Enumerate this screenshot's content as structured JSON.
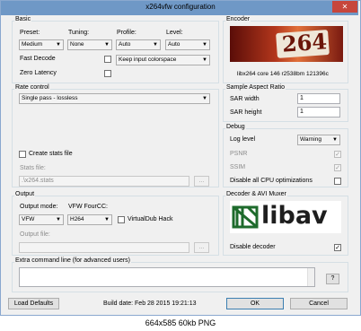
{
  "window": {
    "title": "x264vfw configuration",
    "close_label": "✕"
  },
  "basic": {
    "title": "Basic",
    "preset_label": "Preset:",
    "preset_value": "Medium",
    "tuning_label": "Tuning:",
    "tuning_value": "None",
    "profile_label": "Profile:",
    "profile_value": "Auto",
    "level_label": "Level:",
    "level_value": "Auto",
    "fast_decode_label": "Fast Decode",
    "zero_latency_label": "Zero Latency",
    "colorspace_value": "Keep input colorspace"
  },
  "encoder": {
    "title": "Encoder",
    "logo_text": "264",
    "core_text": "libx264 core 146 r2538bm 121396c"
  },
  "rate_control": {
    "title": "Rate control",
    "mode_value": "Single pass - lossless",
    "create_stats_label": "Create stats file",
    "stats_file_label": "Stats file:",
    "stats_file_value": ".\\x264.stats",
    "browse_label": "..."
  },
  "sar": {
    "title": "Sample Aspect Ratio",
    "width_label": "SAR width",
    "width_value": "1",
    "height_label": "SAR height",
    "height_value": "1"
  },
  "debug": {
    "title": "Debug",
    "log_level_label": "Log level",
    "log_level_value": "Warning",
    "psnr_label": "PSNR",
    "ssim_label": "SSIM",
    "disable_cpu_label": "Disable all CPU optimizations"
  },
  "output": {
    "title": "Output",
    "mode_label": "Output mode:",
    "mode_value": "VFW",
    "fourcc_label": "VFW FourCC:",
    "fourcc_value": "H264",
    "virtualdub_label": "VirtualDub Hack",
    "file_label": "Output file:",
    "browse_label": "..."
  },
  "decoder": {
    "title": "Decoder & AVI Muxer",
    "logo_text": "libav",
    "disable_decoder_label": "Disable decoder"
  },
  "extra": {
    "title": "Extra command line (for advanced users)",
    "help_label": "?"
  },
  "footer": {
    "load_defaults_label": "Load Defaults",
    "build_date": "Build date: Feb 28 2015 19:21:13",
    "ok_label": "OK",
    "cancel_label": "Cancel"
  },
  "caption": "664x585 60kb PNG",
  "colors": {
    "title_bar": "#6f98c6",
    "close_button": "#c7463c",
    "logo_bg": "#8b1a10"
  }
}
